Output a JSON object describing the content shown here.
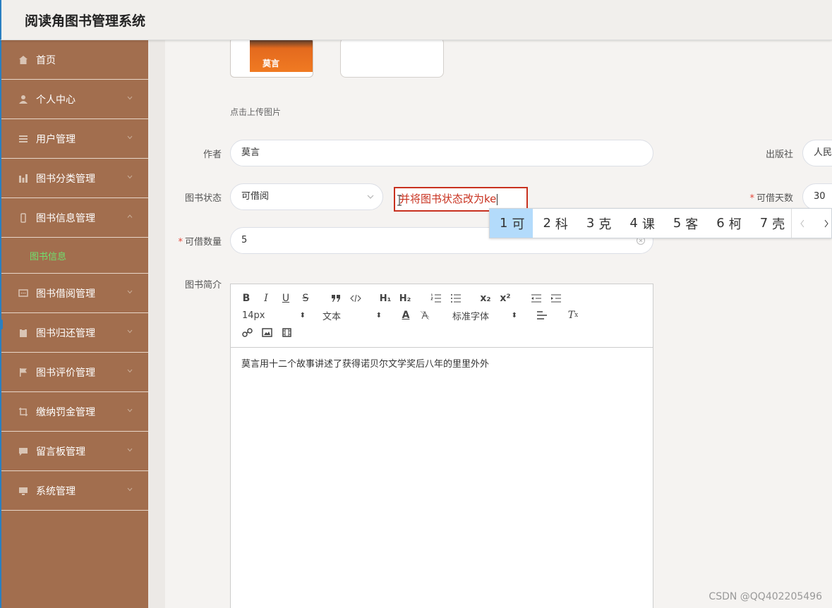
{
  "app": {
    "title": "阅读角图书管理系统"
  },
  "sidebar": {
    "items": [
      {
        "label": "首页",
        "icon": "home-icon"
      },
      {
        "label": "个人中心",
        "icon": "user-icon"
      },
      {
        "label": "用户管理",
        "icon": "list-icon"
      },
      {
        "label": "图书分类管理",
        "icon": "chart-icon"
      },
      {
        "label": "图书信息管理",
        "icon": "phone-icon"
      },
      {
        "label": "图书借阅管理",
        "icon": "message-icon"
      },
      {
        "label": "图书归还管理",
        "icon": "clipboard-icon"
      },
      {
        "label": "图书评价管理",
        "icon": "flag-icon"
      },
      {
        "label": "缴纳罚金管理",
        "icon": "crop-icon"
      },
      {
        "label": "留言板管理",
        "icon": "chat-icon"
      },
      {
        "label": "系统管理",
        "icon": "monitor-icon"
      }
    ],
    "active_sub": "图书信息"
  },
  "form": {
    "upload_hint": "点击上传图片",
    "book_cover_title": "莫言",
    "author": {
      "label": "作者",
      "value": "莫言"
    },
    "publisher": {
      "label": "出版社",
      "value": "人民"
    },
    "status": {
      "label": "图书状态",
      "value": "可借阅"
    },
    "days": {
      "label": "可借天数",
      "value": "30"
    },
    "quantity": {
      "label": "可借数量",
      "value": "5"
    },
    "intro": {
      "label": "图书简介"
    }
  },
  "overlay": {
    "text": "并将图书状态改为ke"
  },
  "ime": {
    "candidates": [
      {
        "num": "1",
        "char": "可"
      },
      {
        "num": "2",
        "char": "科"
      },
      {
        "num": "3",
        "char": "克"
      },
      {
        "num": "4",
        "char": "课"
      },
      {
        "num": "5",
        "char": "客"
      },
      {
        "num": "6",
        "char": "柯"
      },
      {
        "num": "7",
        "char": "壳"
      }
    ]
  },
  "editor": {
    "font_size": "14px",
    "block_type": "文本",
    "font_family": "标准字体",
    "content": "莫言用十二个故事讲述了获得诺贝尔文学奖后八年的里里外外"
  },
  "watermark": "CSDN @QQ402205496"
}
